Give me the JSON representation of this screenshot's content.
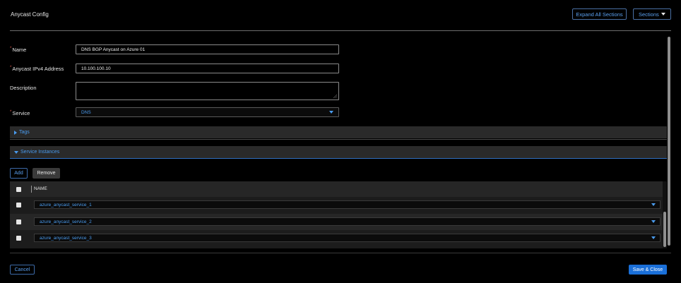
{
  "header": {
    "title": "Anycast Config",
    "expand_label": "Expand All Sections",
    "sections_label": "Sections"
  },
  "form": {
    "name_label": "Name",
    "name_value": "DNS BGP Anycast on Azure 01",
    "ipv4_label": "Anycast IPv4 Address",
    "ipv4_value": "10.100.100.10",
    "description_label": "Description",
    "description_value": "",
    "service_label": "Service",
    "service_value": "DNS",
    "required_mark": "*"
  },
  "sections": {
    "tags_label": "Tags",
    "service_instances_label": "Service Instances"
  },
  "service_instances": {
    "add_label": "Add",
    "remove_label": "Remove",
    "column_name": "NAME",
    "rows": [
      "azure_anycast_service_1",
      "azure_anycast_service_2",
      "azure_anycast_service_3"
    ]
  },
  "footer": {
    "cancel_label": "Cancel",
    "save_label": "Save & Close"
  },
  "colors": {
    "accent": "#4a9cf0",
    "primary_button": "#1a6fd8",
    "required": "#e05a4f",
    "background": "#000000"
  }
}
